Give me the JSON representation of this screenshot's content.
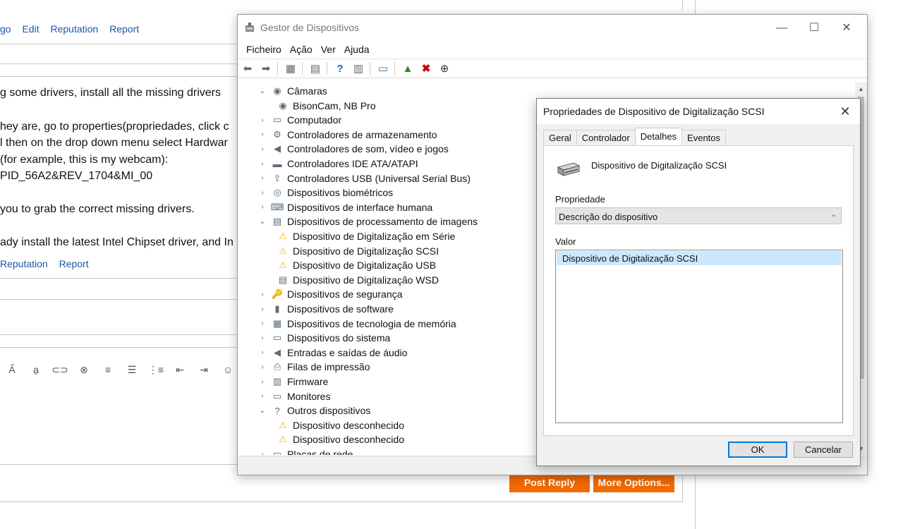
{
  "forum": {
    "actions_top": [
      "go",
      "Edit",
      "Reputation",
      "Report"
    ],
    "actions_bottom": [
      "Reputation",
      "Report"
    ],
    "post_lines": [
      "g some drivers, install all the missing drivers",
      "hey are, go to properties(propriedades, click c",
      "l then on the drop down menu select Hardwar",
      "(for example, this is my webcam):",
      "PID_56A2&REV_1704&MI_00",
      "you to grab the correct missing drivers.",
      "ady install the latest Intel Chipset driver, and In"
    ],
    "post_reply_label": "Post Reply",
    "more_options_label": "More Options..."
  },
  "device_manager": {
    "title": "Gestor de Dispositivos",
    "menu": [
      "Ficheiro",
      "Ação",
      "Ver",
      "Ajuda"
    ],
    "tree": [
      {
        "label": "Câmaras",
        "level": 0,
        "expanded": true,
        "icon": "webcam-icon",
        "glyph": "◉"
      },
      {
        "label": "BisonCam, NB Pro",
        "level": 1,
        "icon": "webcam-icon",
        "glyph": "◉"
      },
      {
        "label": "Computador",
        "level": 0,
        "icon": "monitor-icon",
        "glyph": "▭"
      },
      {
        "label": "Controladores de armazenamento",
        "level": 0,
        "icon": "storage-icon",
        "glyph": "⚙"
      },
      {
        "label": "Controladores de som, vídeo e jogos",
        "level": 0,
        "icon": "speaker-icon",
        "glyph": "◀"
      },
      {
        "label": "Controladores IDE ATA/ATAPI",
        "level": 0,
        "icon": "ide-icon",
        "glyph": "▬"
      },
      {
        "label": "Controladores USB (Universal Serial Bus)",
        "level": 0,
        "icon": "usb-icon",
        "glyph": "⇪"
      },
      {
        "label": "Dispositivos biométricos",
        "level": 0,
        "icon": "fingerprint-icon",
        "glyph": "◎"
      },
      {
        "label": "Dispositivos de interface humana",
        "level": 0,
        "icon": "keyboard-icon",
        "glyph": "⌨"
      },
      {
        "label": "Dispositivos de processamento de imagens",
        "level": 0,
        "expanded": true,
        "icon": "scanner-icon",
        "glyph": "▤"
      },
      {
        "label": "Dispositivo de Digitalização em Série",
        "level": 1,
        "icon": "scanner-warning-icon",
        "glyph": "⚠"
      },
      {
        "label": "Dispositivo de Digitalização SCSI",
        "level": 1,
        "icon": "scanner-warning-icon",
        "glyph": "⚠"
      },
      {
        "label": "Dispositivo de Digitalização USB",
        "level": 1,
        "icon": "scanner-warning-icon",
        "glyph": "⚠"
      },
      {
        "label": "Dispositivo de Digitalização WSD",
        "level": 1,
        "icon": "scanner-icon",
        "glyph": "▤"
      },
      {
        "label": "Dispositivos de segurança",
        "level": 0,
        "icon": "security-key-icon",
        "glyph": "🔑"
      },
      {
        "label": "Dispositivos de software",
        "level": 0,
        "icon": "software-device-icon",
        "glyph": "▮"
      },
      {
        "label": "Dispositivos de tecnologia de memória",
        "level": 0,
        "icon": "memory-icon",
        "glyph": "▦"
      },
      {
        "label": "Dispositivos do sistema",
        "level": 0,
        "icon": "system-folder-icon",
        "glyph": "▭"
      },
      {
        "label": "Entradas e saídas de áudio",
        "level": 0,
        "icon": "speaker-icon",
        "glyph": "◀"
      },
      {
        "label": "Filas de impressão",
        "level": 0,
        "icon": "printer-icon",
        "glyph": "⎙"
      },
      {
        "label": "Firmware",
        "level": 0,
        "icon": "firmware-icon",
        "glyph": "▥"
      },
      {
        "label": "Monitores",
        "level": 0,
        "icon": "monitor-icon",
        "glyph": "▭"
      },
      {
        "label": "Outros dispositivos",
        "level": 0,
        "expanded": true,
        "icon": "unknown-device-icon",
        "glyph": "?"
      },
      {
        "label": "Dispositivo desconhecido",
        "level": 1,
        "icon": "unknown-warning-icon",
        "glyph": "⚠"
      },
      {
        "label": "Dispositivo desconhecido",
        "level": 1,
        "icon": "unknown-warning-icon",
        "glyph": "⚠"
      },
      {
        "label": "Placas de rede",
        "level": 0,
        "icon": "network-icon",
        "glyph": "▭"
      }
    ]
  },
  "properties": {
    "title": "Propriedades de Dispositivo de Digitalização SCSI",
    "tabs": [
      "Geral",
      "Controlador",
      "Detalhes",
      "Eventos"
    ],
    "active_tab": "Detalhes",
    "device_name": "Dispositivo de Digitalização SCSI",
    "property_label": "Propriedade",
    "property_value": "Descrição do dispositivo",
    "value_label": "Valor",
    "value_item": "Dispositivo de Digitalização SCSI",
    "ok_label": "OK",
    "cancel_label": "Cancelar"
  },
  "colors": {
    "warning": "#f2b600",
    "accent": "#0078d7",
    "selection": "#cce8ff",
    "forum_button": "#f26a00",
    "link": "#1a57a6"
  }
}
